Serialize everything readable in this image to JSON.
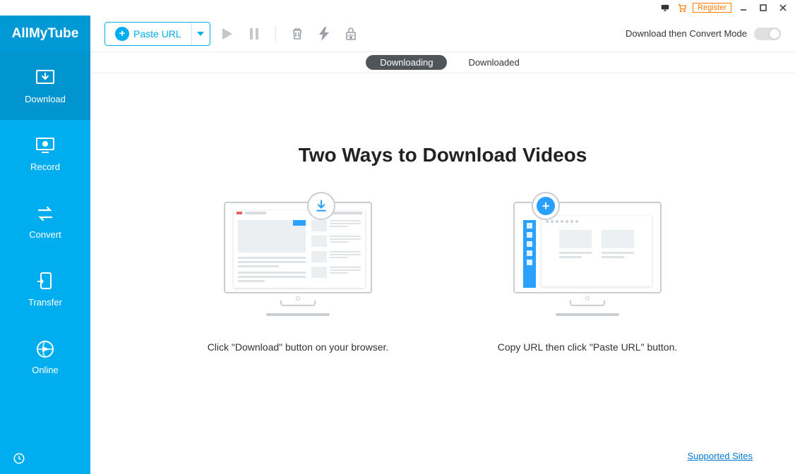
{
  "app": {
    "name": "AllMyTube"
  },
  "titlebar": {
    "register": "Register"
  },
  "sidebar": {
    "items": [
      {
        "label": "Download"
      },
      {
        "label": "Record"
      },
      {
        "label": "Convert"
      },
      {
        "label": "Transfer"
      },
      {
        "label": "Online"
      }
    ]
  },
  "toolbar": {
    "paste_url": "Paste URL",
    "mode_label": "Download then Convert Mode"
  },
  "tabs": {
    "downloading": "Downloading",
    "downloaded": "Downloaded"
  },
  "content": {
    "headline": "Two Ways to Download Videos",
    "card1": "Click \"Download\" button on your browser.",
    "card2": "Copy URL then click \"Paste URL\" button."
  },
  "footer": {
    "supported_sites": "Supported Sites"
  }
}
